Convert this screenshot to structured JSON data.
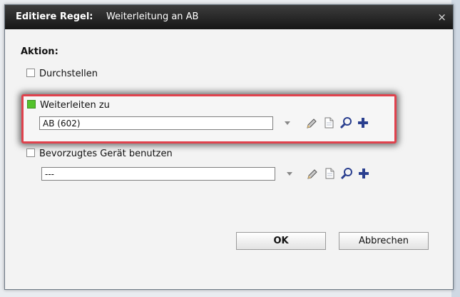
{
  "dialog": {
    "title_label": "Editiere Regel:",
    "title_value": "Weiterleitung an AB",
    "close_glyph": "×"
  },
  "section": {
    "label": "Aktion:"
  },
  "options": {
    "durchstellen": {
      "label": "Durchstellen",
      "checked": false
    },
    "weiterleiten": {
      "label": "Weiterleiten zu",
      "checked": true,
      "value": "AB (602)"
    },
    "bevorzugt": {
      "label": "Bevorzugtes Gerät benutzen",
      "checked": false,
      "value": "---"
    }
  },
  "icons": [
    "pencil-icon",
    "document-icon",
    "search-icon",
    "plus-icon"
  ],
  "buttons": {
    "ok": "OK",
    "cancel": "Abbrechen"
  },
  "colors": {
    "highlight": "#e0424d",
    "checkbox_checked": "#53c22b",
    "icon_blue": "#2a3f8f"
  }
}
